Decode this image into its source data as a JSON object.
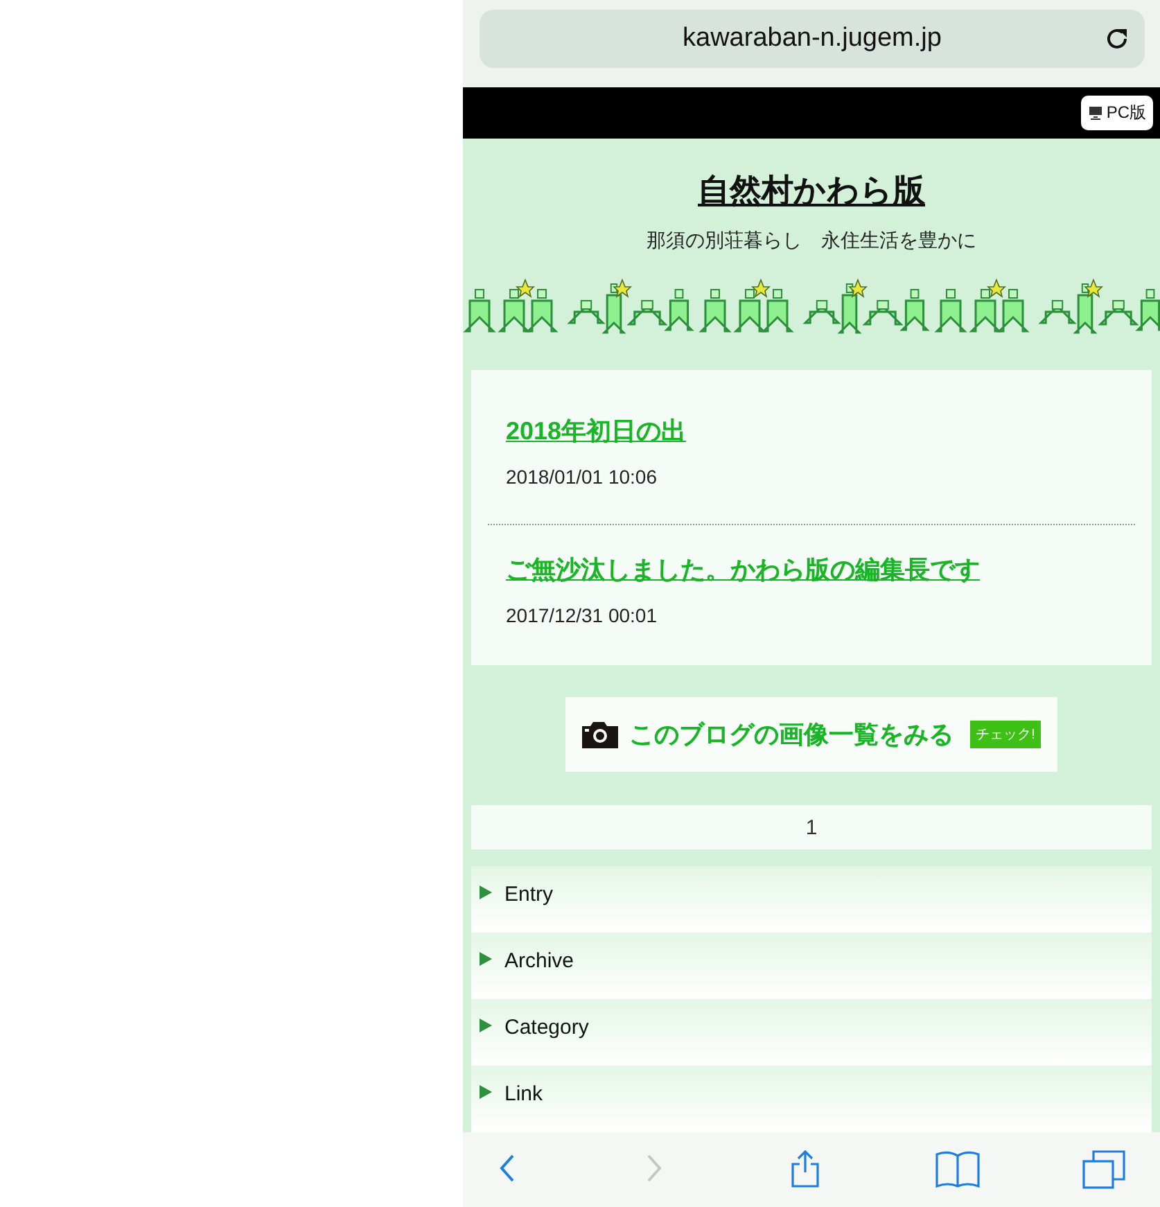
{
  "browser": {
    "url": "kawaraban-n.jugem.jp"
  },
  "top_bar": {
    "pc_button": "PC版"
  },
  "blog": {
    "title": "自然村かわら版",
    "tagline": "那須の別荘暮らし　永住生活を豊かに"
  },
  "entries": [
    {
      "title": "2018年初日の出",
      "date": "2018/01/01 10:06"
    },
    {
      "title": "ご無沙汰しました。かわら版の編集長です",
      "date": "2017/12/31 00:01"
    }
  ],
  "gallery": {
    "label": "このブログの画像一覧をみる",
    "badge": "チェック!"
  },
  "pager": [
    {
      "label": "1",
      "selected": true
    }
  ],
  "menu": [
    {
      "label": "Entry"
    },
    {
      "label": "Archive"
    },
    {
      "label": "Category"
    },
    {
      "label": "Link"
    }
  ],
  "toolbar": [
    {
      "kind": "back",
      "disabled": false
    },
    {
      "kind": "forward",
      "disabled": true
    },
    {
      "kind": "share",
      "disabled": false
    },
    {
      "kind": "bookmarks",
      "disabled": false
    },
    {
      "kind": "tabs",
      "disabled": false
    }
  ]
}
